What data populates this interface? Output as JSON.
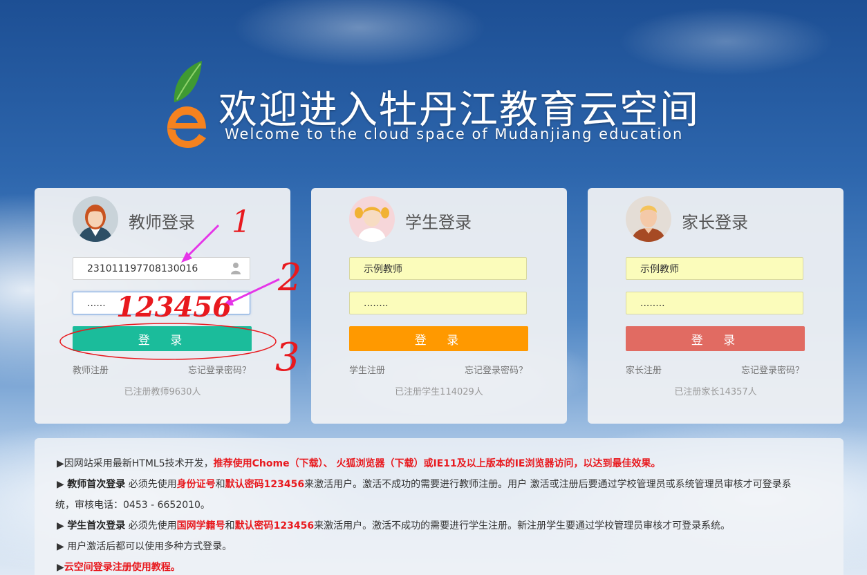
{
  "header": {
    "title_cn": "欢迎进入牡丹江教育云空间",
    "title_en": "Welcome to the cloud space of Mudanjiang education"
  },
  "cards": {
    "teacher": {
      "title": "教师登录",
      "username_value": "231011197708130016",
      "password_value": "......",
      "login_label": "登 录",
      "register_label": "教师注册",
      "forgot_label": "忘记登录密码？",
      "registered_count": "已注册教师9630人",
      "button_color": "#1bbc9b"
    },
    "student": {
      "title": "学生登录",
      "username_value": "示例教师",
      "password_value": "........",
      "login_label": "登 录",
      "register_label": "学生注册",
      "forgot_label": "忘记登录密码？",
      "registered_count": "已注册学生114029人",
      "button_color": "#ff9900"
    },
    "parent": {
      "title": "家长登录",
      "username_value": "示例教师",
      "password_value": "........",
      "login_label": "登 录",
      "register_label": "家长注册",
      "forgot_label": "忘记登录密码？",
      "registered_count": "已注册家长14357人",
      "button_color": "#e16b62"
    }
  },
  "notice": {
    "line1_a": "▶因网站采用最新HTML5技术开发，",
    "line1_b": "推荐使用Chome（下载）、 火狐浏览器（下载）或IE11及以上版本的IE浏览器访问，以达到最佳效果。",
    "line2_a": "▶ ",
    "line2_b": "教师首次登录",
    "line2_c": " 必须先使用",
    "line2_d": "身份证号",
    "line2_e": "和",
    "line2_f": "默认密码123456",
    "line2_g": "来激活用户。激活不成功的需要进行教师注册。用户 激活或注册后要通过学校管理员或系统管理员审核才可登录系",
    "line3": "统，审核电话：0453 - 6652010。",
    "line4_a": "▶ ",
    "line4_b": "学生首次登录",
    "line4_c": " 必须先使用",
    "line4_d": "国网学籍号",
    "line4_e": "和",
    "line4_f": "默认密码123456",
    "line4_g": "来激活用户。激活不成功的需要进行学生注册。新注册学生要通过学校管理员审核才可登录系统。",
    "line5": "▶ 用户激活后都可以使用多种方式登录。",
    "line6_a": "▶",
    "line6_b": "云空间登录注册使用教程。"
  },
  "annotations": {
    "mark_1": "1",
    "mark_2": "2",
    "mark_3": "3",
    "handwritten_password": "123456"
  }
}
